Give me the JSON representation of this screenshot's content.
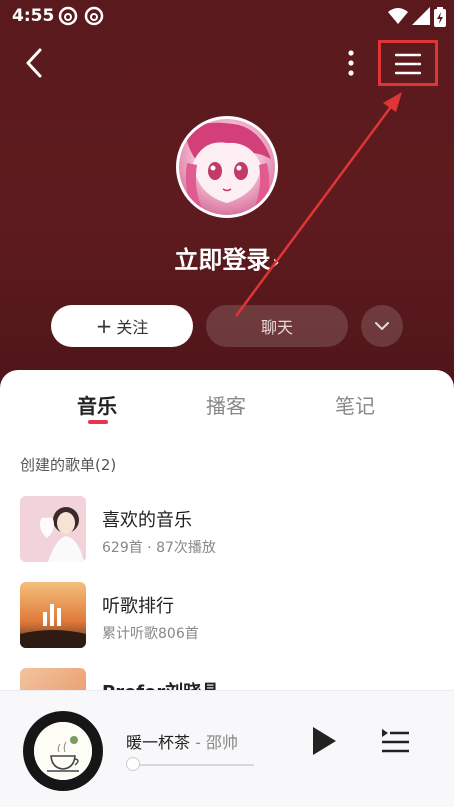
{
  "status_bar": {
    "time": "4:55"
  },
  "profile": {
    "login_label": "立即登录",
    "login_chevron": "›"
  },
  "actions": {
    "follow_label": "关注",
    "chat_label": "聊天"
  },
  "tabs": [
    {
      "label": "音乐"
    },
    {
      "label": "播客"
    },
    {
      "label": "笔记"
    }
  ],
  "section": {
    "created_playlists": "创建的歌单(2)"
  },
  "playlists": [
    {
      "title": "喜欢的音乐",
      "meta": "629首 · 87次播放"
    },
    {
      "title": "听歌排行",
      "meta": "累计听歌806首"
    },
    {
      "title": "Prefer刘晓晶",
      "meta": ""
    }
  ],
  "player": {
    "song": "暖一杯茶",
    "artist": " - 邵帅",
    "cover_text": "暖一杯茶"
  },
  "colors": {
    "hero": "#5a1a1d",
    "accent": "#e8344e",
    "highlight_box": "#e03535"
  },
  "icons": [
    "back-icon",
    "more-vertical-icon",
    "menu-icon",
    "chevron-down-icon",
    "plus-icon",
    "play-icon",
    "playlist-queue-icon"
  ]
}
